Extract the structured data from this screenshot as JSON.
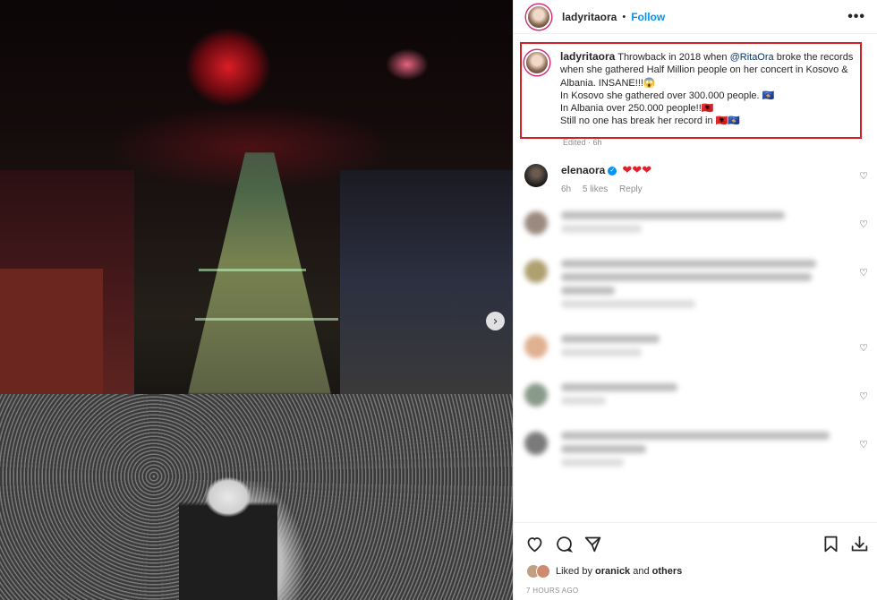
{
  "post": {
    "username": "ladyritaora",
    "follow_label": "Follow",
    "more_label": "•••"
  },
  "caption": {
    "username": "ladyritaora",
    "text_before_mention": "Throwback in 2018 when",
    "mention": "@RitaOra",
    "text_after_mention": "broke the records when she gathered Half Million people on her concert in Kosovo & Albania. INSANE!!!😱",
    "line2": "In Kosovo she gathered over 300.000 people. 🇽🇰",
    "line3": "In Albania over 250.000 people!!🇦🇱",
    "line4": "Still no one has break her record in 🇦🇱🇽🇰",
    "edited": "Edited · 6h"
  },
  "comments": [
    {
      "username": "elenaora",
      "verified": true,
      "text": "❤❤❤",
      "time": "6h",
      "likes": "5 likes",
      "reply": "Reply"
    }
  ],
  "actions": {
    "liked_prefix": "Liked by",
    "liked_user": "oranick",
    "liked_connector": "and",
    "liked_others": "others",
    "timestamp": "7 HOURS AGO"
  },
  "icons": {
    "next": "›",
    "heart": "♡"
  }
}
